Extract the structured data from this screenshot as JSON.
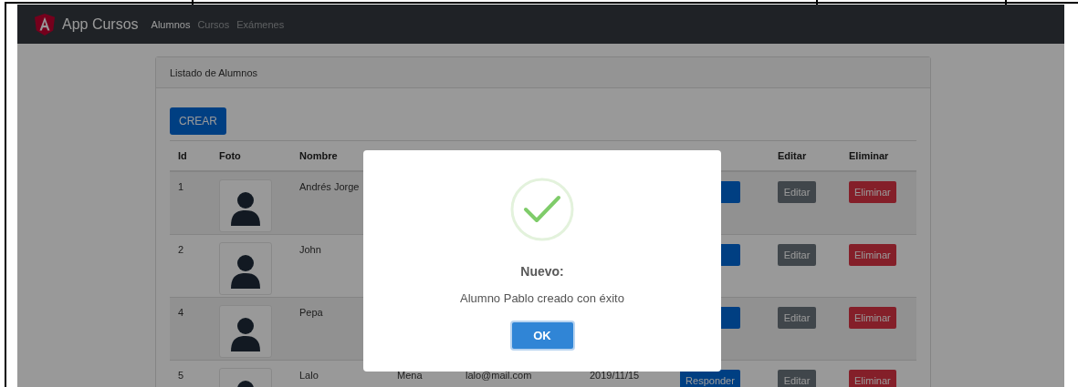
{
  "navbar": {
    "brand": "App Cursos",
    "links": [
      {
        "label": "Alumnos",
        "selected": true
      },
      {
        "label": "Cursos",
        "selected": false
      },
      {
        "label": "Exámenes",
        "selected": false
      }
    ]
  },
  "card": {
    "title": "Listado de Alumnos",
    "create_button": "CREAR"
  },
  "table": {
    "columns": [
      {
        "label": "Id"
      },
      {
        "label": "Foto"
      },
      {
        "label": "Nombre"
      },
      {},
      {},
      {},
      {},
      {
        "label": "Editar"
      },
      {
        "label": "Eliminar"
      }
    ],
    "rows": [
      {
        "id": "1",
        "nombre": "Andrés Jorge",
        "editar": "Editar",
        "eliminar": "Eliminar"
      },
      {
        "id": "2",
        "nombre": "John",
        "editar": "Editar",
        "eliminar": "Eliminar"
      },
      {
        "id": "4",
        "nombre": "Pepa",
        "editar": "Editar",
        "eliminar": "Eliminar"
      },
      {
        "id": "5",
        "nombre": "Lalo",
        "apellido": "Mena",
        "email": "lalo@mail.com",
        "fecha": "2019/11/15",
        "responder": "Responder",
        "editar": "Editar",
        "eliminar": "Eliminar"
      }
    ]
  },
  "dialog": {
    "title": "Nuevo:",
    "message": "Alumno Pablo creado con éxito",
    "button": "OK"
  }
}
